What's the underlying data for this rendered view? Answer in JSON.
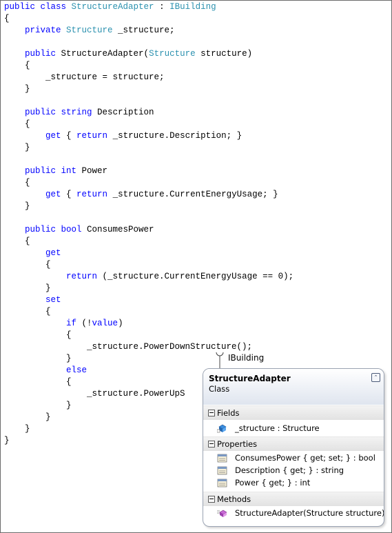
{
  "code": {
    "lines": [
      [
        {
          "t": "public class ",
          "c": "kw"
        },
        {
          "t": "StructureAdapter",
          "c": "ty"
        },
        {
          "t": " : "
        },
        {
          "t": "IBuilding",
          "c": "ty"
        }
      ],
      [
        {
          "t": "{"
        }
      ],
      [
        {
          "t": "    "
        },
        {
          "t": "private ",
          "c": "kw"
        },
        {
          "t": "Structure",
          "c": "ty"
        },
        {
          "t": " _structure;"
        }
      ],
      [],
      [
        {
          "t": "    "
        },
        {
          "t": "public ",
          "c": "kw"
        },
        {
          "t": "StructureAdapter("
        },
        {
          "t": "Structure",
          "c": "ty"
        },
        {
          "t": " structure)"
        }
      ],
      [
        {
          "t": "    {"
        }
      ],
      [
        {
          "t": "        _structure = structure;"
        }
      ],
      [
        {
          "t": "    }"
        }
      ],
      [],
      [
        {
          "t": "    "
        },
        {
          "t": "public string ",
          "c": "kw"
        },
        {
          "t": "Description"
        }
      ],
      [
        {
          "t": "    {"
        }
      ],
      [
        {
          "t": "        "
        },
        {
          "t": "get",
          "c": "kw"
        },
        {
          "t": " { "
        },
        {
          "t": "return",
          "c": "kw"
        },
        {
          "t": " _structure.Description; }"
        }
      ],
      [
        {
          "t": "    }"
        }
      ],
      [],
      [
        {
          "t": "    "
        },
        {
          "t": "public int ",
          "c": "kw"
        },
        {
          "t": "Power"
        }
      ],
      [
        {
          "t": "    {"
        }
      ],
      [
        {
          "t": "        "
        },
        {
          "t": "get",
          "c": "kw"
        },
        {
          "t": " { "
        },
        {
          "t": "return",
          "c": "kw"
        },
        {
          "t": " _structure.CurrentEnergyUsage; }"
        }
      ],
      [
        {
          "t": "    }"
        }
      ],
      [],
      [
        {
          "t": "    "
        },
        {
          "t": "public bool ",
          "c": "kw"
        },
        {
          "t": "ConsumesPower"
        }
      ],
      [
        {
          "t": "    {"
        }
      ],
      [
        {
          "t": "        "
        },
        {
          "t": "get",
          "c": "kw"
        }
      ],
      [
        {
          "t": "        {"
        }
      ],
      [
        {
          "t": "            "
        },
        {
          "t": "return",
          "c": "kw"
        },
        {
          "t": " (_structure.CurrentEnergyUsage == 0);"
        }
      ],
      [
        {
          "t": "        }"
        }
      ],
      [
        {
          "t": "        "
        },
        {
          "t": "set",
          "c": "kw"
        }
      ],
      [
        {
          "t": "        {"
        }
      ],
      [
        {
          "t": "            "
        },
        {
          "t": "if",
          "c": "kw"
        },
        {
          "t": " (!"
        },
        {
          "t": "value",
          "c": "kw"
        },
        {
          "t": ")"
        }
      ],
      [
        {
          "t": "            {"
        }
      ],
      [
        {
          "t": "                _structure.PowerDownStructure();"
        }
      ],
      [
        {
          "t": "            }"
        }
      ],
      [
        {
          "t": "            "
        },
        {
          "t": "else",
          "c": "kw"
        }
      ],
      [
        {
          "t": "            {"
        }
      ],
      [
        {
          "t": "                _structure.PowerUpS"
        }
      ],
      [
        {
          "t": "            }"
        }
      ],
      [
        {
          "t": "        }"
        }
      ],
      [
        {
          "t": "    }"
        }
      ],
      [
        {
          "t": "}"
        }
      ]
    ]
  },
  "diagram": {
    "interface_label": "IBuilding",
    "class_name": "StructureAdapter",
    "class_kind": "Class",
    "sections": [
      {
        "title": "Fields",
        "members": [
          {
            "icon": "field-icon",
            "text": "_structure : Structure"
          }
        ]
      },
      {
        "title": "Properties",
        "members": [
          {
            "icon": "property-icon",
            "text": "ConsumesPower { get; set; } : bool"
          },
          {
            "icon": "property-icon",
            "text": "Description { get; } : string"
          },
          {
            "icon": "property-icon",
            "text": "Power { get; } : int"
          }
        ]
      },
      {
        "title": "Methods",
        "members": [
          {
            "icon": "method-icon",
            "text": "StructureAdapter(Structure structure)"
          }
        ]
      }
    ],
    "colors": {
      "keyword": "#0000ff",
      "type": "#2b91af",
      "header_gradient_end": "#dfe5ef"
    }
  }
}
